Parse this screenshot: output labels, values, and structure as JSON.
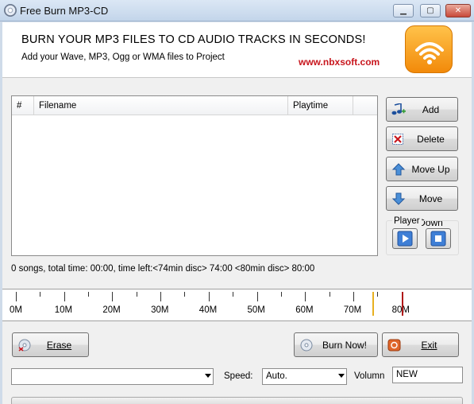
{
  "window": {
    "title": "Free Burn MP3-CD",
    "minimize_glyph": "▁",
    "maximize_glyph": "▢",
    "close_glyph": "✕"
  },
  "banner": {
    "headline": "BURN YOUR MP3 FILES TO CD AUDIO TRACKS IN SECONDS!",
    "subline": "Add your Wave, MP3, Ogg or WMA files to Project",
    "url": "www.nbxsoft.com",
    "logo_icon": "wifi-broadcast-icon",
    "url_color": "#c8161d",
    "logo_color": "#f7a21b"
  },
  "file_list": {
    "columns": [
      "#",
      "Filename",
      "Playtime"
    ],
    "rows": []
  },
  "actions": {
    "add_label": "Add",
    "delete_label": "Delete",
    "move_up_label": "Move Up",
    "move_down_label": "Move Down"
  },
  "player": {
    "label": "Player",
    "play_icon": "play-icon",
    "stop_icon": "stop-icon"
  },
  "status": {
    "text": "0 songs, total time: 00:00, time left:<74min disc> 74:00 <80min disc> 80:00"
  },
  "ruler": {
    "labels": [
      "0M",
      "10M",
      "20M",
      "30M",
      "40M",
      "50M",
      "60M",
      "70M",
      "80M"
    ],
    "marker_74min_color": "#e8b020",
    "marker_80min_color": "#b01818"
  },
  "buttons": {
    "erase_label": "Erase",
    "burn_label": "Burn Now!",
    "exit_label": "Exit"
  },
  "settings": {
    "drive_value": "",
    "speed_label": "Speed:",
    "speed_value": "Auto.",
    "volume_label": "Volumn",
    "volume_value": "NEW"
  }
}
